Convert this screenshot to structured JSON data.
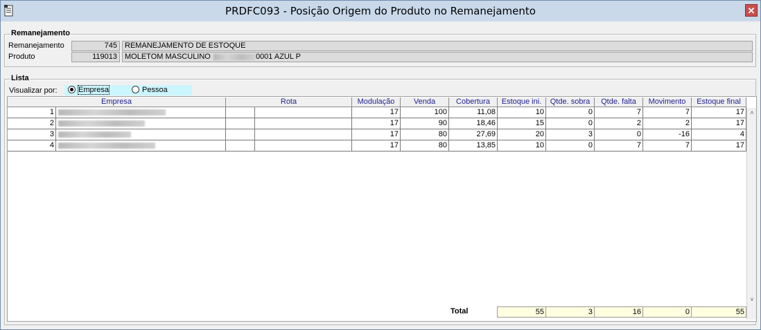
{
  "window": {
    "title": "PRDFC093 - Posição Origem do Produto no Remanejamento",
    "close_glyph": "✕"
  },
  "remanejamento_group": {
    "legend": "Remanejamento",
    "remanejamento_label": "Remanejamento",
    "remanejamento_code": "745",
    "remanejamento_desc": "REMANEJAMENTO DE ESTOQUE",
    "produto_label": "Produto",
    "produto_code": "119013",
    "produto_desc_prefix": "MOLETOM MASCULINO",
    "produto_desc_suffix": "0001 AZUL P"
  },
  "lista_group": {
    "legend": "Lista",
    "visualizar_label": "Visualizar por:",
    "option_empresa": "Empresa",
    "option_pessoa": "Pessoa",
    "selected": "Empresa"
  },
  "table": {
    "headers": {
      "empresa": "Empresa",
      "rota": "Rota",
      "modulacao": "Modulação",
      "venda": "Venda",
      "cobertura": "Cobertura",
      "estoque_ini": "Estoque ini.",
      "qtde_sobra": "Qtde. sobra",
      "qtde_falta": "Qtde. falta",
      "movimento": "Movimento",
      "estoque_final": "Estoque final"
    },
    "rows": [
      {
        "idx": "1",
        "modulacao": "17",
        "venda": "100",
        "cobertura": "11,08",
        "estoque_ini": "10",
        "qtde_sobra": "0",
        "qtde_falta": "7",
        "movimento": "7",
        "estoque_final": "17"
      },
      {
        "idx": "2",
        "modulacao": "17",
        "venda": "90",
        "cobertura": "18,46",
        "estoque_ini": "15",
        "qtde_sobra": "0",
        "qtde_falta": "2",
        "movimento": "2",
        "estoque_final": "17"
      },
      {
        "idx": "3",
        "modulacao": "17",
        "venda": "80",
        "cobertura": "27,69",
        "estoque_ini": "20",
        "qtde_sobra": "3",
        "qtde_falta": "0",
        "movimento": "-16",
        "estoque_final": "4"
      },
      {
        "idx": "4",
        "modulacao": "17",
        "venda": "80",
        "cobertura": "13,85",
        "estoque_ini": "10",
        "qtde_sobra": "0",
        "qtde_falta": "7",
        "movimento": "7",
        "estoque_final": "17"
      }
    ],
    "scroll_up": "˄",
    "scroll_down": "˅"
  },
  "totals": {
    "label": "Total",
    "estoque_ini": "55",
    "qtde_sobra": "3",
    "qtde_falta": "16",
    "movimento": "0",
    "estoque_final": "55"
  }
}
